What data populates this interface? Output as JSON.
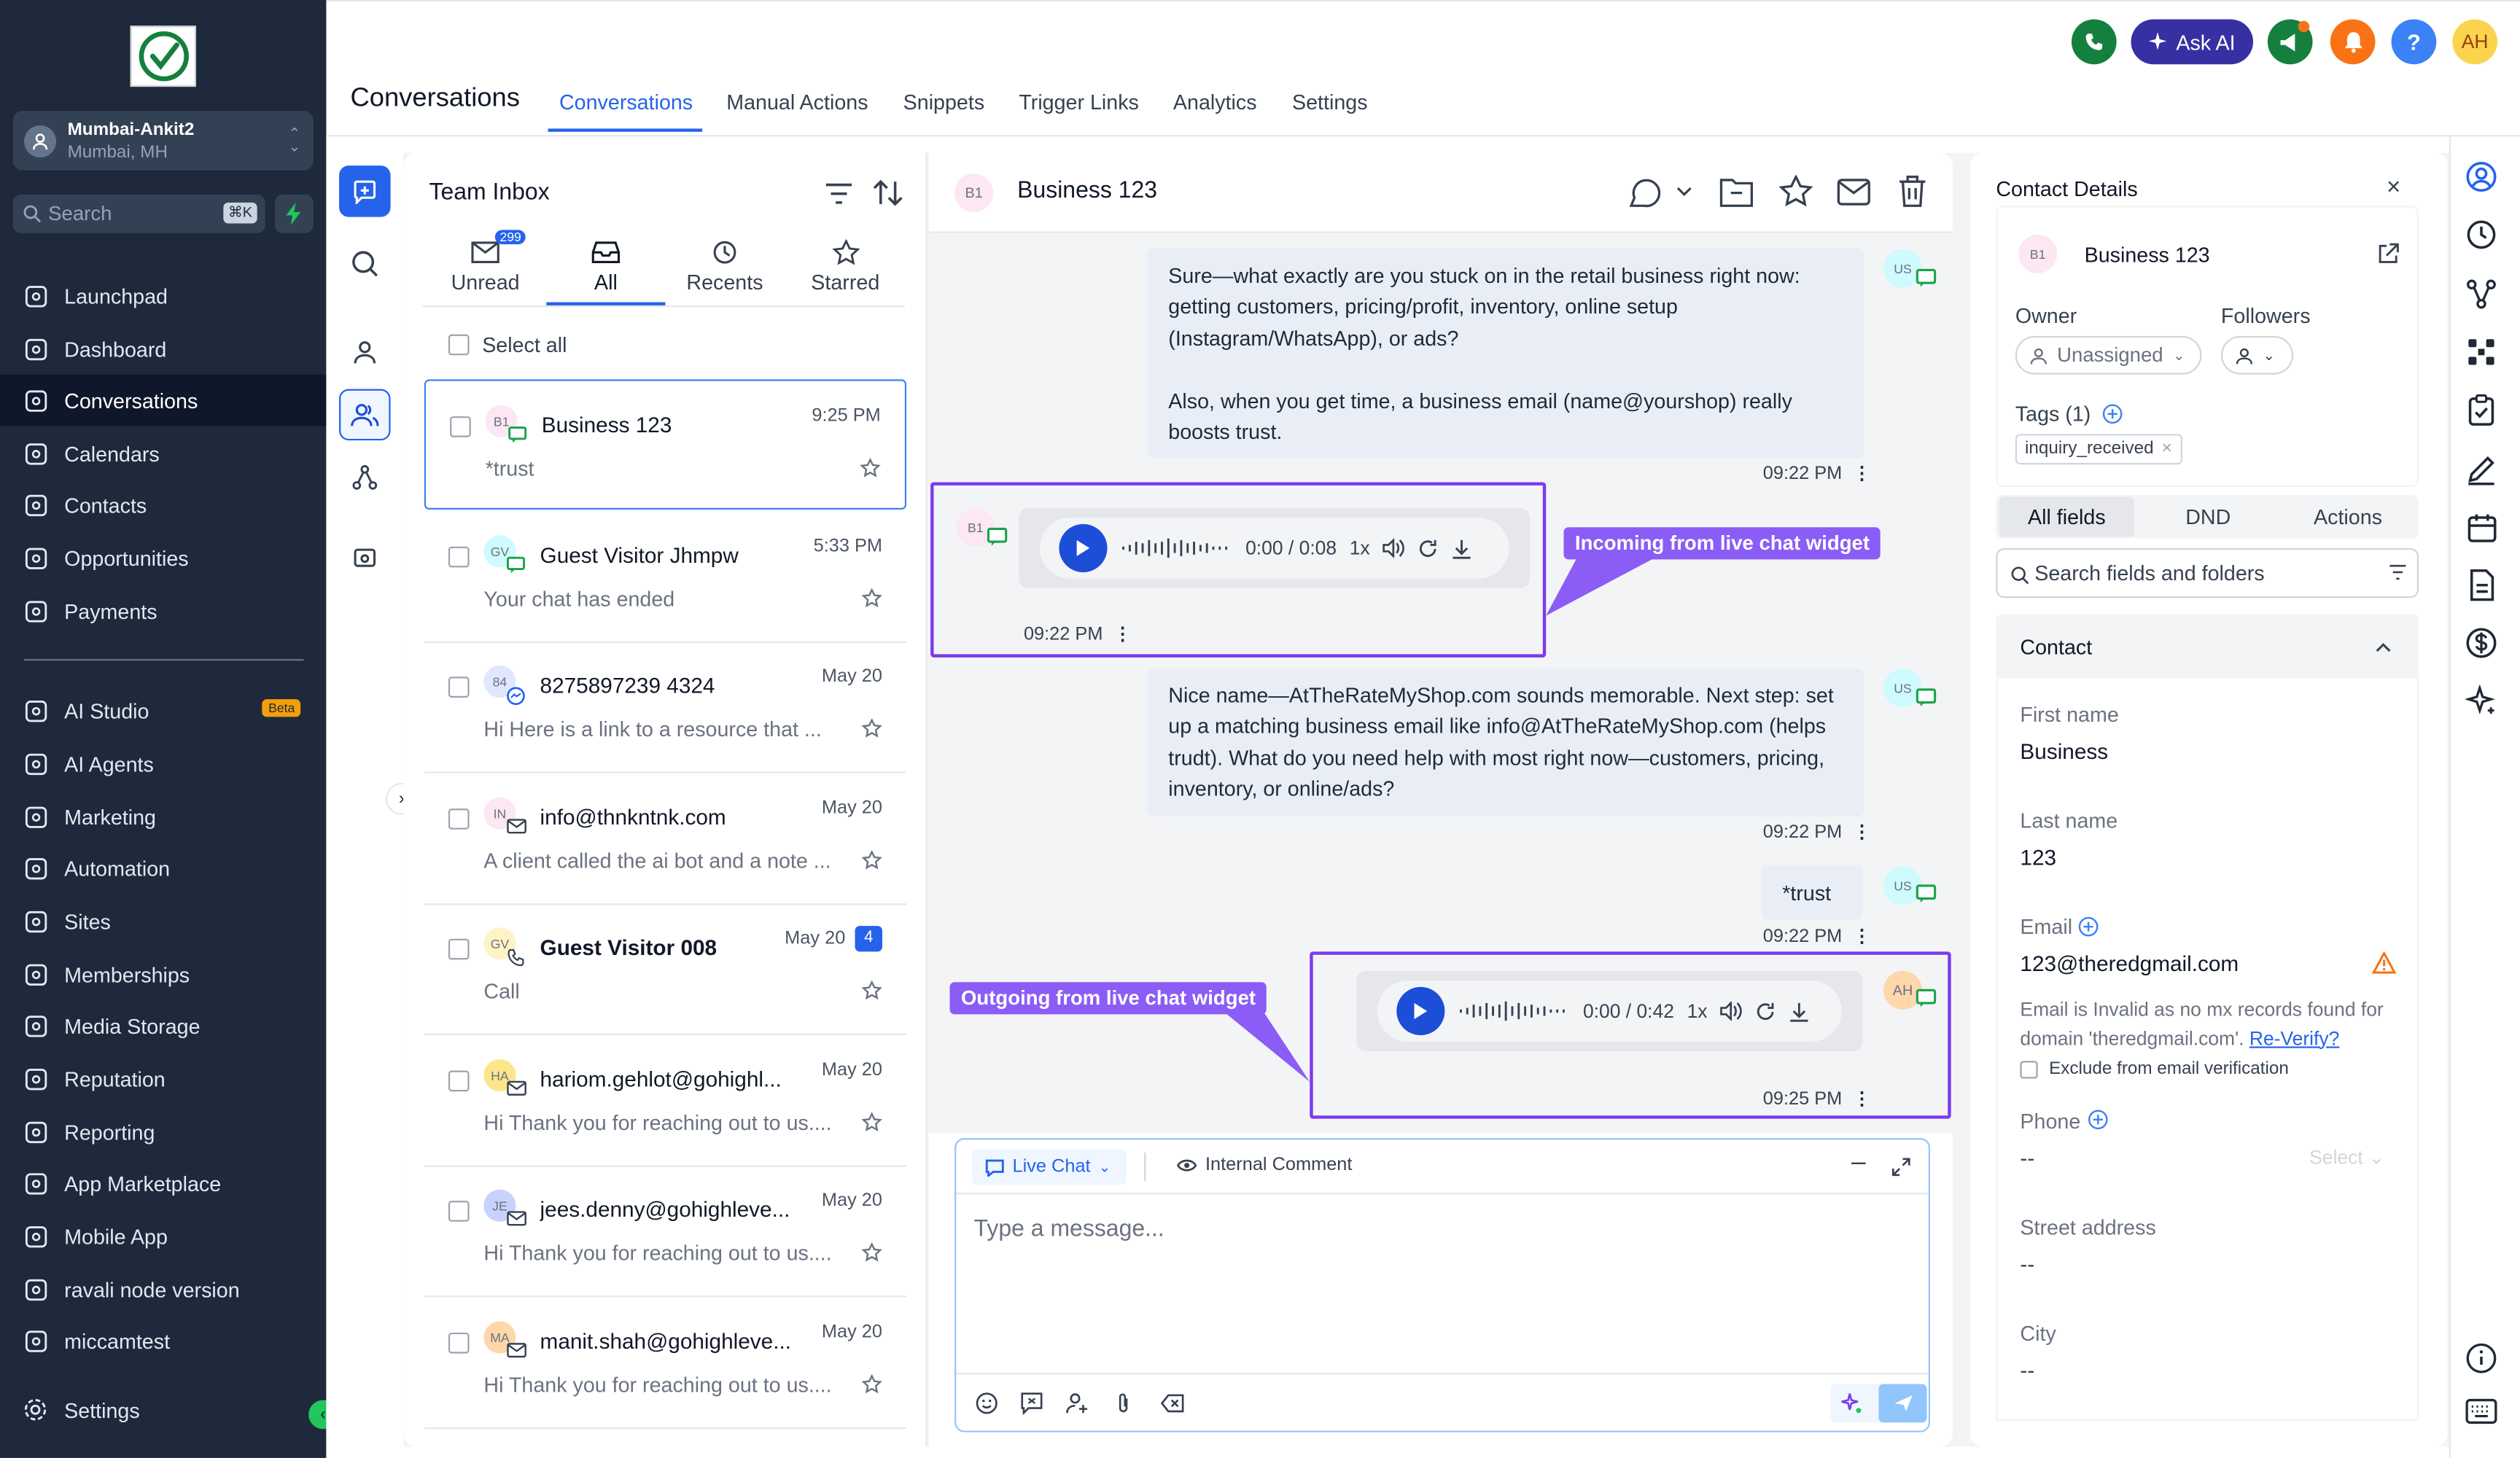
{
  "sidebar": {
    "account": {
      "name": "Mumbai-Ankit2",
      "location": "Mumbai, MH"
    },
    "search": {
      "placeholder": "Search",
      "shortcut": "⌘K"
    },
    "items": [
      {
        "label": "Launchpad",
        "icon": "rocket-icon"
      },
      {
        "label": "Dashboard",
        "icon": "grid-icon"
      },
      {
        "label": "Conversations",
        "icon": "chat-icon",
        "active": true
      },
      {
        "label": "Calendars",
        "icon": "calendar-icon"
      },
      {
        "label": "Contacts",
        "icon": "contacts-icon"
      },
      {
        "label": "Opportunities",
        "icon": "opportunities-icon"
      },
      {
        "label": "Payments",
        "icon": "payments-icon"
      },
      {
        "label": "AI Studio",
        "icon": "ai-studio-icon",
        "badge": "Beta"
      },
      {
        "label": "AI Agents",
        "icon": "sparkle-icon"
      },
      {
        "label": "Marketing",
        "icon": "send-icon"
      },
      {
        "label": "Automation",
        "icon": "automation-icon"
      },
      {
        "label": "Sites",
        "icon": "sites-icon"
      },
      {
        "label": "Memberships",
        "icon": "membership-icon"
      },
      {
        "label": "Media Storage",
        "icon": "image-icon"
      },
      {
        "label": "Reputation",
        "icon": "star-icon"
      },
      {
        "label": "Reporting",
        "icon": "trend-icon"
      },
      {
        "label": "App Marketplace",
        "icon": "apps-icon"
      },
      {
        "label": "Mobile App",
        "icon": "mobile-icon"
      },
      {
        "label": "ravali node version",
        "icon": "bank-icon"
      },
      {
        "label": "miccamtest",
        "icon": "video-icon"
      }
    ],
    "settings_label": "Settings"
  },
  "header": {
    "title": "Conversations",
    "tabs": [
      "Conversations",
      "Manual Actions",
      "Snippets",
      "Trigger Links",
      "Analytics",
      "Settings"
    ],
    "ask_ai": "Ask AI",
    "avatar": "AH"
  },
  "inbox": {
    "title": "Team Inbox",
    "filters": [
      {
        "label": "Unread",
        "badge": "299"
      },
      {
        "label": "All"
      },
      {
        "label": "Recents"
      },
      {
        "label": "Starred"
      }
    ],
    "select_all": "Select all",
    "conversations": [
      {
        "initials": "B1",
        "name": "Business 123",
        "time": "9:25 PM",
        "preview": "*trust",
        "channel": "chat",
        "avbg": "#fce7f3"
      },
      {
        "initials": "GV",
        "name": "Guest Visitor Jhmpw",
        "time": "5:33 PM",
        "preview": "Your chat has ended",
        "channel": "chat",
        "avbg": "#cffafe"
      },
      {
        "initials": "84",
        "name": "8275897239 4324",
        "time": "May 20",
        "preview": "Hi Here is a link to a resource that ...",
        "channel": "messenger",
        "avbg": "#e0e7ff"
      },
      {
        "initials": "IN",
        "name": "info@thnkntnk.com",
        "time": "May 20",
        "preview": "A client called the ai bot and a note ...",
        "channel": "email",
        "avbg": "#fce7f3"
      },
      {
        "initials": "GV",
        "name": "Guest Visitor 008",
        "time": "May 20",
        "preview": "Call",
        "channel": "phone",
        "count": "4",
        "avbg": "#fef3c7"
      },
      {
        "initials": "HA",
        "name": "hariom.gehlot@gohighl...",
        "time": "May 20",
        "preview": "Hi Thank you for reaching out to us....",
        "channel": "email",
        "avbg": "#fde68a"
      },
      {
        "initials": "JE",
        "name": "jees.denny@gohighleve...",
        "time": "May 20",
        "preview": "Hi Thank you for reaching out to us....",
        "channel": "email",
        "avbg": "#c7d2fe"
      },
      {
        "initials": "MA",
        "name": "manit.shah@gohighleve...",
        "time": "May 20",
        "preview": "Hi Thank you for reaching out to us....",
        "channel": "email",
        "avbg": "#fed7aa"
      }
    ]
  },
  "chat": {
    "initials": "B1",
    "title": "Business 123",
    "messages": [
      {
        "text": "Sure—what exactly are you stuck on in the retail business right now: getting customers, pricing/profit, inventory, online setup (Instagram/WhatsApp), or ads?\n\nAlso, when you get time, a business email (name@yourshop) really boosts trust.",
        "time": "09:22 PM",
        "avatar": "US"
      },
      {
        "audio_time": "0:00 / 0:08",
        "speed": "1x",
        "time": "09:22 PM",
        "avatar": "B1"
      },
      {
        "text": "Nice name—AtTheRateMyShop.com sounds memorable. Next step: set up a matching business email like info@AtTheRateMyShop.com (helps trudt). What do you need help with most right now—customers, pricing, inventory, or online/ads?",
        "time": "09:22 PM",
        "avatar": "US"
      },
      {
        "text": "*trust",
        "time": "09:22 PM",
        "avatar": "US"
      },
      {
        "audio_time": "0:00 / 0:42",
        "speed": "1x",
        "time": "09:25 PM",
        "avatar": "AH"
      }
    ],
    "callouts": {
      "incoming": "Incoming from live chat widget",
      "outgoing": "Outgoing from live chat widget"
    },
    "composer": {
      "channel": "Live Chat",
      "internal": "Internal Comment",
      "placeholder": "Type a message..."
    }
  },
  "contact": {
    "header": "Contact Details",
    "initials": "B1",
    "name": "Business 123",
    "owner_label": "Owner",
    "owner_value": "Unassigned",
    "followers_label": "Followers",
    "tags_label": "Tags (1)",
    "tag": "inquiry_received",
    "tabs": [
      "All fields",
      "DND",
      "Actions"
    ],
    "search_placeholder": "Search fields and folders",
    "section": "Contact",
    "fields": {
      "first_name_label": "First name",
      "first_name": "Business",
      "last_name_label": "Last name",
      "last_name": "123",
      "email_label": "Email",
      "email": "123@theredgmail.com",
      "email_warning": "Email is Invalid as no mx records found for domain 'theredgmail.com'.",
      "reverify": "Re-Verify?",
      "exclude": "Exclude from email verification",
      "phone_label": "Phone",
      "phone": "--",
      "phone_select": "Select",
      "street_label": "Street address",
      "street": "--",
      "city_label": "City",
      "city": "--"
    }
  },
  "colors": {
    "sidebar": "#1e293b",
    "accent": "#2563eb",
    "highlight": "#7c3aed",
    "callout": "#8b5cf6"
  }
}
